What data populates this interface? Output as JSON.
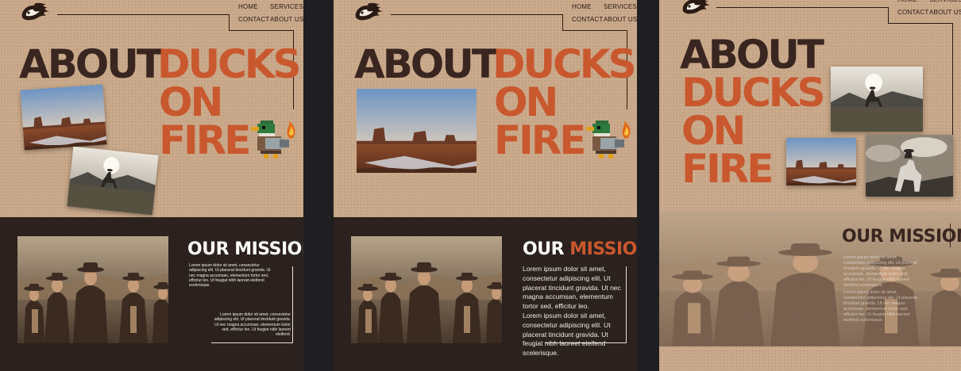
{
  "nav": {
    "home": "HOME",
    "services": "SERVICES",
    "contact": "CONTACT",
    "about": "ABOUT US"
  },
  "hero": {
    "word1": "ABOUT",
    "word2": "DUCKS",
    "word3": "ON",
    "word4": "FIRE"
  },
  "mission": {
    "word1": "OUR",
    "word2": "MISSION",
    "para1": "Lorem ipsum dolor sit amet, consectetur adipiscing elit. Ut placerat tincidunt gravida. Ut nec magna accumsan, elementum tortor sed, efficitur leo.",
    "para2": "Lorem ipsum dolor sit amet, consectetur adipiscing elit. Ut placerat tincidunt gravida. Ut feugiat nibh laoreet eleifend scelerisque."
  },
  "p1": {
    "para1": "Lorem ipsum dolor sit amet, consectetur adipiscing elit. Ut placerat tincidunt gravida. Ut nec magna accumsan, elementum tortor sed, efficitur leo. Ut feugiat nibh laoreet eleifend scelerisque.",
    "para2": "Lorem ipsum dolor sit amet, consectetur adipiscing elit. Ut placerat tincidunt gravida. Ut nec magna accumsan, elementum tortor sed, efficitur leo. Ut feugiat nibh laoreet eleifend."
  },
  "p3": {
    "para1": "Lorem ipsum dolor sit amet, consectetur adipiscing elit. Ut placerat tincidunt gravida. Ut nec magna accumsan, elementum tortor sed, efficitur leo. Ut feugiat nibh laoreet eleifend scelerisque.",
    "para2": "Lorem ipsum dolor sit amet, consectetur adipiscing elit. Ut placerat tincidunt gravida. Ut nec magna accumsan, elementum tortor sed, efficitur leo. Ut feugiat nibh laoreet eleifend scelerisque."
  },
  "colors": {
    "sand": "#caa98a",
    "dark": "#2b211e",
    "orange": "#c9582e",
    "brown": "#3a2620"
  }
}
